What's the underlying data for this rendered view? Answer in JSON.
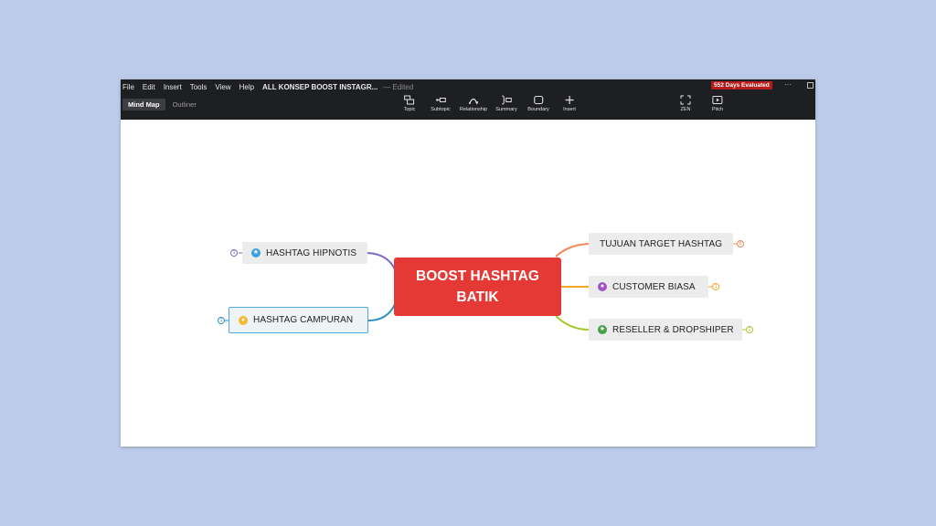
{
  "menu": {
    "file": "File",
    "edit": "Edit",
    "insert": "Insert",
    "tools": "Tools",
    "view": "View",
    "help": "Help",
    "doc_title": "ALL KONSEP BOOST INSTAGR...",
    "edited": "— Edited"
  },
  "badge": {
    "evaluated": "552 Days Evaluated"
  },
  "window": {
    "more": "···"
  },
  "view_tabs": {
    "mind_map": "Mind Map",
    "outliner": "Outliner"
  },
  "tools": {
    "topic": "Topic",
    "subtopic": "Subtopic",
    "relationship": "Relationship",
    "summary": "Summary",
    "boundary": "Boundary",
    "insert": "Insert",
    "zen": "ZEN",
    "pitch": "Pitch"
  },
  "mindmap": {
    "central": "BOOST HASHTAG BATIK",
    "topics": {
      "hipnotis": "HASHTAG HIPNOTIS",
      "campuran": "HASHTAG CAMPURAN",
      "tujuan": "TUJUAN TARGET HASHTAG",
      "customer": "CUSTOMER BIASA",
      "reseller": "RESELLER & DROPSHIPER"
    },
    "counts": {
      "hipnotis": "1",
      "campuran": "1",
      "tujuan": "8",
      "customer": "1",
      "reseller": "1"
    }
  },
  "colors": {
    "central": "#e53935",
    "hipnotis": "#7b68c8",
    "campuran": "#2a8fbd",
    "tujuan": "#f08a5d",
    "customer": "#f5a623",
    "reseller": "#a5c92b",
    "badge": "#b71c1c"
  },
  "icons": {
    "hipnotis": "star-badge-icon",
    "campuran": "person-icon",
    "customer": "person-icon",
    "reseller": "star-badge-icon"
  }
}
